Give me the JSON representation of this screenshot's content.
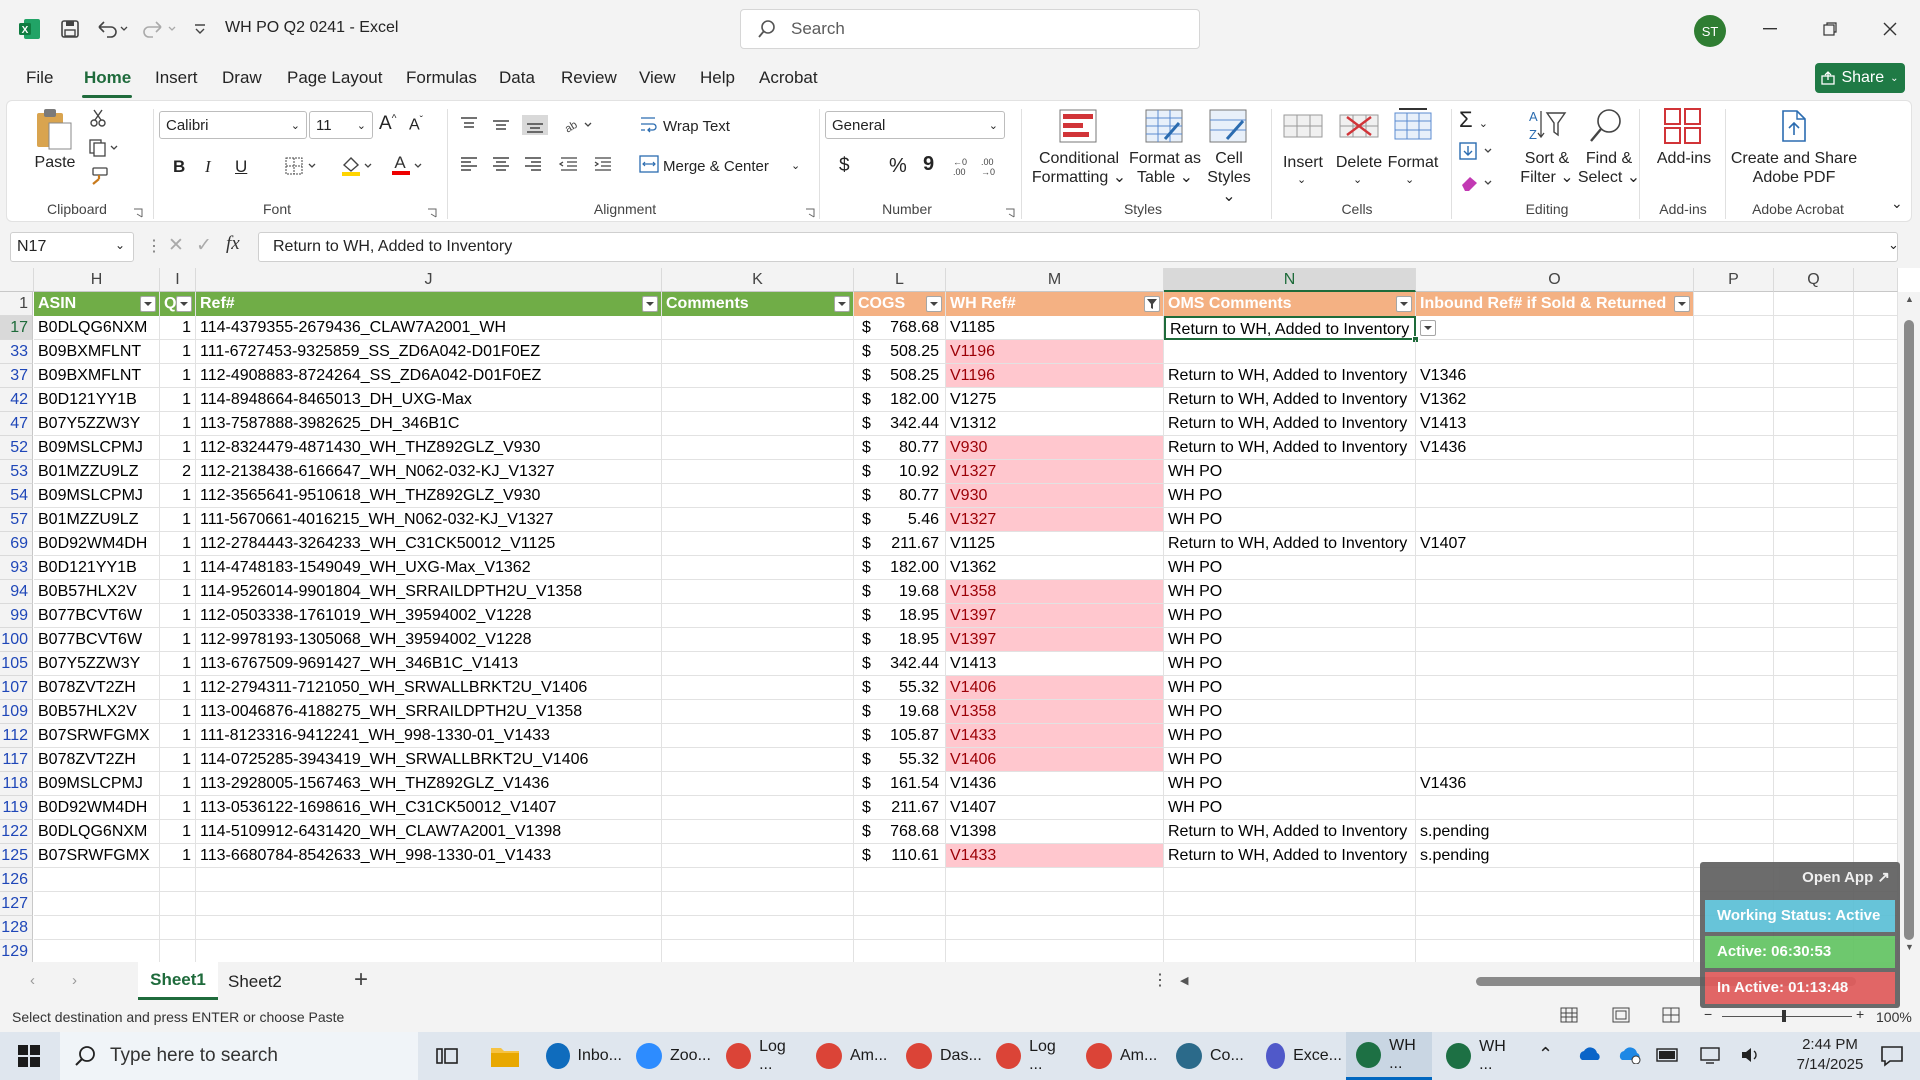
{
  "window": {
    "title": "WH PO Q2 0241  -  Excel",
    "search_placeholder": "Search",
    "avatar_initials": "ST"
  },
  "menu": {
    "items": [
      "File",
      "Home",
      "Insert",
      "Draw",
      "Page Layout",
      "Formulas",
      "Data",
      "Review",
      "View",
      "Help",
      "Acrobat"
    ],
    "active": "Home",
    "share_label": "Share"
  },
  "ribbon": {
    "clipboard": {
      "paste": "Paste",
      "label": "Clipboard"
    },
    "font": {
      "name": "Calibri",
      "size": "11",
      "label": "Font",
      "bold": "B",
      "italic": "I",
      "underline": "U"
    },
    "alignment": {
      "wrap": "Wrap Text",
      "merge": "Merge & Center",
      "label": "Alignment"
    },
    "number": {
      "format": "General",
      "currency": "$",
      "percent": "%",
      "comma": "9",
      "label": "Number"
    },
    "styles": {
      "conditional": "Conditional\nFormatting",
      "format_table": "Format as\nTable",
      "cell_styles": "Cell\nStyles",
      "label": "Styles"
    },
    "cells": {
      "insert": "Insert",
      "delete": "Delete",
      "format": "Format",
      "label": "Cells"
    },
    "editing": {
      "sort": "Sort &\nFilter",
      "find": "Find &\nSelect",
      "label": "Editing"
    },
    "addins": {
      "addins": "Add-ins",
      "label": "Add-ins"
    },
    "acrobat": {
      "create": "Create and Share\nAdobe PDF",
      "label": "Adobe Acrobat"
    }
  },
  "formula_bar": {
    "name_box": "N17",
    "fx": "fx",
    "content": "Return to WH, Added to Inventory"
  },
  "sheet": {
    "columns": [
      "H",
      "I",
      "J",
      "K",
      "L",
      "M",
      "N",
      "O",
      "P",
      "Q"
    ],
    "header_row": {
      "row": "1",
      "asin": "ASIN",
      "q": "Q",
      "ref": "Ref#",
      "comments": "Comments",
      "cogs": "COGS",
      "wh_ref": "WH Ref#",
      "oms": "OMS Comments",
      "inbound": "Inbound Ref# if Sold & Returned"
    },
    "rows": [
      {
        "r": "17",
        "asin": "B0DLQG6NXM",
        "q": "1",
        "ref": "114-4379355-2679436_CLAW7A2001_WH",
        "cur": "$",
        "cogs": "768.68",
        "wh": "V1185",
        "pink": false,
        "oms": "Return to WH, Added to Inventory",
        "inb": ""
      },
      {
        "r": "33",
        "asin": "B09BXMFLNT",
        "q": "1",
        "ref": "111-6727453-9325859_SS_ZD6A042-D01F0EZ",
        "cur": "$",
        "cogs": "508.25",
        "wh": "V1196",
        "pink": true,
        "oms": "",
        "inb": ""
      },
      {
        "r": "37",
        "asin": "B09BXMFLNT",
        "q": "1",
        "ref": "112-4908883-8724264_SS_ZD6A042-D01F0EZ",
        "cur": "$",
        "cogs": "508.25",
        "wh": "V1196",
        "pink": true,
        "oms": "Return to WH, Added to Inventory",
        "inb": "V1346"
      },
      {
        "r": "42",
        "asin": "B0D121YY1B",
        "q": "1",
        "ref": "114-8948664-8465013_DH_UXG-Max",
        "cur": "$",
        "cogs": "182.00",
        "wh": "V1275",
        "pink": false,
        "oms": "Return to WH, Added to Inventory",
        "inb": "V1362"
      },
      {
        "r": "47",
        "asin": "B07Y5ZZW3Y",
        "q": "1",
        "ref": "113-7587888-3982625_DH_346B1C",
        "cur": "$",
        "cogs": "342.44",
        "wh": "V1312",
        "pink": false,
        "oms": "Return to WH, Added to Inventory",
        "inb": "V1413"
      },
      {
        "r": "52",
        "asin": "B09MSLCPMJ",
        "q": "1",
        "ref": "112-8324479-4871430_WH_THZ892GLZ_V930",
        "cur": "$",
        "cogs": "80.77",
        "wh": "V930",
        "pink": true,
        "oms": "Return to WH, Added to Inventory",
        "inb": "V1436"
      },
      {
        "r": "53",
        "asin": "B01MZZU9LZ",
        "q": "2",
        "ref": "112-2138438-6166647_WH_N062-032-KJ_V1327",
        "cur": "$",
        "cogs": "10.92",
        "wh": "V1327",
        "pink": true,
        "oms": "WH PO",
        "inb": ""
      },
      {
        "r": "54",
        "asin": "B09MSLCPMJ",
        "q": "1",
        "ref": "112-3565641-9510618_WH_THZ892GLZ_V930",
        "cur": "$",
        "cogs": "80.77",
        "wh": "V930",
        "pink": true,
        "oms": "WH PO",
        "inb": ""
      },
      {
        "r": "57",
        "asin": "B01MZZU9LZ",
        "q": "1",
        "ref": "111-5670661-4016215_WH_N062-032-KJ_V1327",
        "cur": "$",
        "cogs": "5.46",
        "wh": "V1327",
        "pink": true,
        "oms": "WH PO",
        "inb": ""
      },
      {
        "r": "69",
        "asin": "B0D92WM4DH",
        "q": "1",
        "ref": "112-2784443-3264233_WH_C31CK50012_V1125",
        "cur": "$",
        "cogs": "211.67",
        "wh": "V1125",
        "pink": false,
        "oms": "Return to WH, Added to Inventory",
        "inb": "V1407"
      },
      {
        "r": "93",
        "asin": "B0D121YY1B",
        "q": "1",
        "ref": "114-4748183-1549049_WH_UXG-Max_V1362",
        "cur": "$",
        "cogs": "182.00",
        "wh": "V1362",
        "pink": false,
        "oms": "WH PO",
        "inb": ""
      },
      {
        "r": "94",
        "asin": "B0B57HLX2V",
        "q": "1",
        "ref": "114-9526014-9901804_WH_SRRAILDPTH2U_V1358",
        "cur": "$",
        "cogs": "19.68",
        "wh": "V1358",
        "pink": true,
        "oms": "WH PO",
        "inb": ""
      },
      {
        "r": "99",
        "asin": "B077BCVT6W",
        "q": "1",
        "ref": "112-0503338-1761019_WH_39594002_V1228",
        "cur": "$",
        "cogs": "18.95",
        "wh": "V1397",
        "pink": true,
        "oms": "WH PO",
        "inb": ""
      },
      {
        "r": "100",
        "asin": "B077BCVT6W",
        "q": "1",
        "ref": "112-9978193-1305068_WH_39594002_V1228",
        "cur": "$",
        "cogs": "18.95",
        "wh": "V1397",
        "pink": true,
        "oms": "WH PO",
        "inb": ""
      },
      {
        "r": "105",
        "asin": "B07Y5ZZW3Y",
        "q": "1",
        "ref": "113-6767509-9691427_WH_346B1C_V1413",
        "cur": "$",
        "cogs": "342.44",
        "wh": "V1413",
        "pink": false,
        "oms": "WH PO",
        "inb": ""
      },
      {
        "r": "107",
        "asin": "B078ZVT2ZH",
        "q": "1",
        "ref": "112-2794311-7121050_WH_SRWALLBRKT2U_V1406",
        "cur": "$",
        "cogs": "55.32",
        "wh": "V1406",
        "pink": true,
        "oms": "WH PO",
        "inb": ""
      },
      {
        "r": "109",
        "asin": "B0B57HLX2V",
        "q": "1",
        "ref": "113-0046876-4188275_WH_SRRAILDPTH2U_V1358",
        "cur": "$",
        "cogs": "19.68",
        "wh": "V1358",
        "pink": true,
        "oms": "WH PO",
        "inb": ""
      },
      {
        "r": "112",
        "asin": "B07SRWFGMX",
        "q": "1",
        "ref": "111-8123316-9412241_WH_998-1330-01_V1433",
        "cur": "$",
        "cogs": "105.87",
        "wh": "V1433",
        "pink": true,
        "oms": "WH PO",
        "inb": ""
      },
      {
        "r": "117",
        "asin": "B078ZVT2ZH",
        "q": "1",
        "ref": "114-0725285-3943419_WH_SRWALLBRKT2U_V1406",
        "cur": "$",
        "cogs": "55.32",
        "wh": "V1406",
        "pink": true,
        "oms": "WH PO",
        "inb": ""
      },
      {
        "r": "118",
        "asin": "B09MSLCPMJ",
        "q": "1",
        "ref": "113-2928005-1567463_WH_THZ892GLZ_V1436",
        "cur": "$",
        "cogs": "161.54",
        "wh": "V1436",
        "pink": false,
        "oms": "WH PO",
        "inb": "V1436"
      },
      {
        "r": "119",
        "asin": "B0D92WM4DH",
        "q": "1",
        "ref": "113-0536122-1698616_WH_C31CK50012_V1407",
        "cur": "$",
        "cogs": "211.67",
        "wh": "V1407",
        "pink": false,
        "oms": "WH PO",
        "inb": ""
      },
      {
        "r": "122",
        "asin": "B0DLQG6NXM",
        "q": "1",
        "ref": "114-5109912-6431420_WH_CLAW7A2001_V1398",
        "cur": "$",
        "cogs": "768.68",
        "wh": "V1398",
        "pink": false,
        "oms": "Return to WH, Added to Inventory",
        "inb": "s.pending"
      },
      {
        "r": "125",
        "asin": "B07SRWFGMX",
        "q": "1",
        "ref": "113-6680784-8542633_WH_998-1330-01_V1433",
        "cur": "$",
        "cogs": "110.61",
        "wh": "V1433",
        "pink": true,
        "oms": "Return to WH, Added to Inventory",
        "inb": "s.pending"
      }
    ],
    "empty_rows": [
      "126",
      "127",
      "128",
      "129"
    ],
    "selected_cell": "N17"
  },
  "tabs": {
    "sheet1": "Sheet1",
    "sheet2": "Sheet2",
    "add": "+"
  },
  "status": {
    "message": "Select destination and press ENTER or choose Paste",
    "zoom": "100%"
  },
  "widget": {
    "open_app": "Open App ↗",
    "working": "Working Status: Active",
    "active": "Active: 06:30:53",
    "inactive": "In Active: 01:13:48"
  },
  "taskbar": {
    "search": "Type here to search",
    "apps": [
      {
        "label": "Inbo...",
        "color": "#0f6cbd"
      },
      {
        "label": "Zoo...",
        "color": "#2d8cff"
      },
      {
        "label": "Log ...",
        "color": "#db4437"
      },
      {
        "label": "Am...",
        "color": "#db4437"
      },
      {
        "label": "Das...",
        "color": "#db4437"
      },
      {
        "label": "Log ...",
        "color": "#db4437"
      },
      {
        "label": "Am...",
        "color": "#db4437"
      },
      {
        "label": "Co...",
        "color": "#2b6a8a"
      },
      {
        "label": "Exce...",
        "color": "#5059c9"
      },
      {
        "label": "WH ...",
        "color": "#1d7044"
      },
      {
        "label": "WH ...",
        "color": "#1d7044"
      }
    ],
    "time": "2:44 PM",
    "date": "7/14/2025"
  },
  "colors": {
    "excel_green": "#1f6b3c",
    "header_green": "#70ad47",
    "header_orange": "#f4b183",
    "pink_fill": "#ffc7ce",
    "pink_text": "#9c0006"
  }
}
